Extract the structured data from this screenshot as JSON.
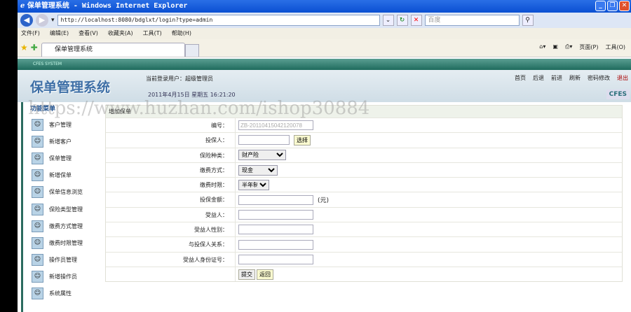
{
  "browser": {
    "title": "保单管理系统 - Windows Internet Explorer",
    "url": "http://localhost:8080/bdglxt/login?type=admin",
    "search_placeholder": "百度",
    "menu": [
      "文件(F)",
      "编辑(E)",
      "查看(V)",
      "收藏夹(A)",
      "工具(T)",
      "帮助(H)"
    ],
    "tab": "保单管理系统",
    "tools": [
      "页面(P)",
      "工具(O)"
    ]
  },
  "app": {
    "system_label": "CFES SYSTEM",
    "logo": "保单管理系统",
    "current_user": "当前登录用户：超级管理员",
    "date": "2011年4月15日 星期五 16:21:20",
    "badge": "CFES",
    "nav": [
      "首页",
      "后退",
      "前进",
      "刷新",
      "密码修改",
      "退出"
    ]
  },
  "sidebar": {
    "title": "功能菜单",
    "items": [
      "客户管理",
      "新增客户",
      "保单管理",
      "新增保单",
      "保单信息浏览",
      "保险类型管理",
      "缴费方式管理",
      "缴费时限管理",
      "操作员管理",
      "新增操作员",
      "系统属性"
    ]
  },
  "form": {
    "title": "增加保单",
    "labels": [
      "编号：",
      "投保人：",
      "保险种类：",
      "缴费方式：",
      "缴费时限：",
      "投保金额：",
      "受益人：",
      "受益人性别：",
      "与投保人关系：",
      "受益人身份证号："
    ],
    "number": "ZB-20110415042120078",
    "choose": "选择",
    "insurance_type": "财产险",
    "pay_method": "现金",
    "pay_term": "半年制",
    "unit": "(元)",
    "submit": "提交",
    "back": "返回"
  },
  "watermark": "https://www.huzhan.com/ishop30884"
}
